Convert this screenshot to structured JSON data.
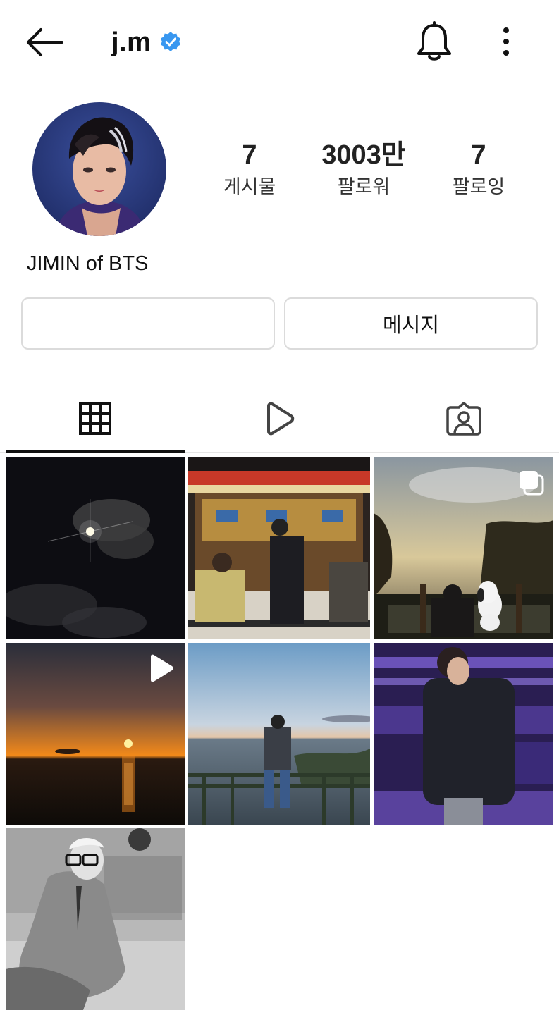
{
  "header": {
    "username": "j.m",
    "icons": {
      "back": "arrow-left-icon",
      "verified": "verified-badge-icon",
      "bell": "bell-icon",
      "more": "more-vertical-icon"
    },
    "verified_color": "#3897f0"
  },
  "profile": {
    "display_name": "JIMIN of BTS",
    "stats": [
      {
        "value": "7",
        "label": "게시물"
      },
      {
        "value": "3003만",
        "label": "팔로워"
      },
      {
        "value": "7",
        "label": "팔로잉"
      }
    ]
  },
  "actions": {
    "follow_label": "",
    "message_label": "메시지"
  },
  "tabs": [
    {
      "name": "posts",
      "icon": "grid-icon",
      "active": true
    },
    {
      "name": "reels",
      "icon": "play-icon",
      "active": false
    },
    {
      "name": "tagged",
      "icon": "tagged-person-icon",
      "active": false
    }
  ],
  "posts": [
    {
      "subject": "moon-night-sky",
      "badge": null
    },
    {
      "subject": "street-market-night",
      "badge": null
    },
    {
      "subject": "park-sunset-snoopy",
      "badge": "carousel-icon"
    },
    {
      "subject": "sea-sunset",
      "badge": "reel-play-icon"
    },
    {
      "subject": "seaside-railing",
      "badge": null
    },
    {
      "subject": "purple-arena",
      "badge": null
    },
    {
      "subject": "black-white-portrait",
      "badge": null
    }
  ]
}
